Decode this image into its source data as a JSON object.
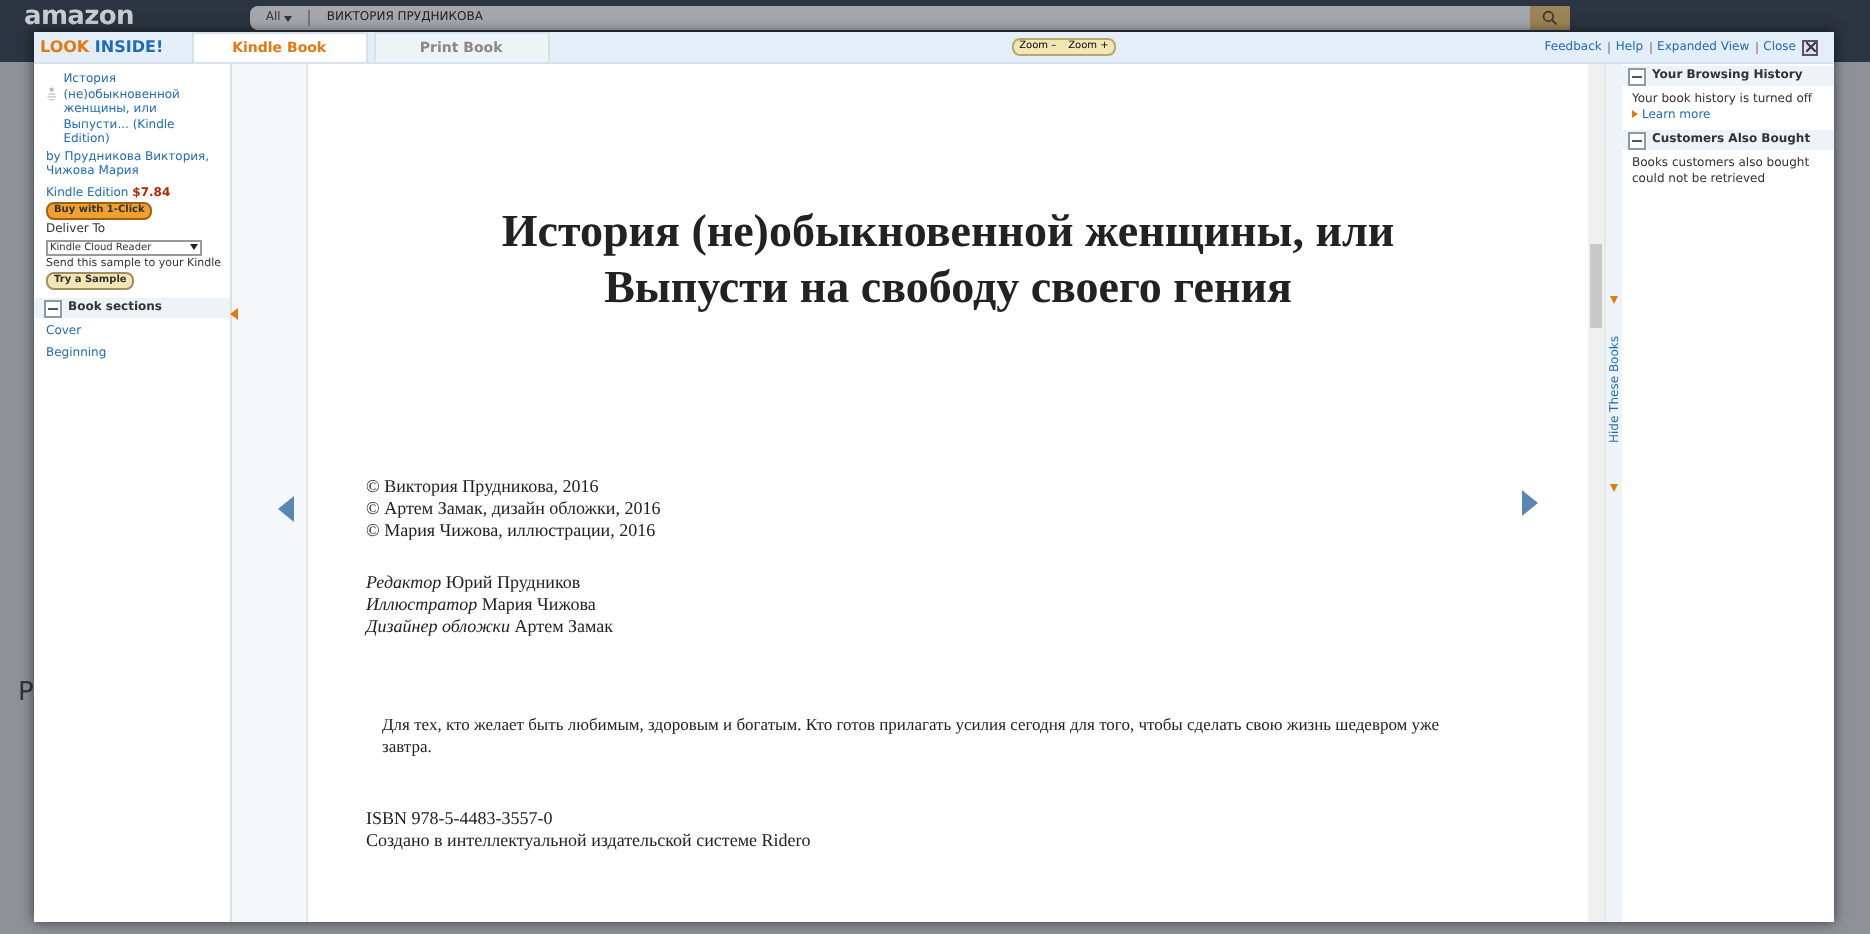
{
  "background": {
    "logo": "amazon",
    "search_scope": "All",
    "search_value": "ВИКТОРИЯ ПРУДНИКОВА",
    "fragments": [
      "P"
    ]
  },
  "viewer": {
    "brand": {
      "first": "LOOK",
      "second": "INSIDE!"
    },
    "tabs": [
      {
        "label": "Kindle Book",
        "selected": true
      },
      {
        "label": "Print Book",
        "selected": false
      }
    ],
    "zoom_buttons": [
      "Zoom –",
      "Zoom +"
    ],
    "header_links": [
      "Feedback",
      "Help",
      "Expanded View",
      "Close"
    ],
    "book": {
      "title": "История (не)обыкновенной женщины, или Выпусти... (Kindle Edition)",
      "author": "by Прудникова Виктория, Чижова Мария",
      "format": "Kindle Edition",
      "price": "$7.84",
      "buy_button": "Buy with 1-Click",
      "deliver_label": "Deliver To",
      "deliver_value": "Kindle Cloud Reader",
      "send_text": "Send this sample to your Kindle",
      "sample_button": "Try a Sample"
    },
    "sections": {
      "title": "Book sections",
      "expanded": true,
      "items": [
        "Cover",
        "Beginning"
      ]
    },
    "page": {
      "title": "История (не)обыкновенной женщины, или Выпусти на свободу своего гения",
      "copyrights": [
        "© Виктория Прудникова, 2016",
        "© Артем Замак, дизайн обложки, 2016",
        "© Мария Чижова, иллюстрации, 2016"
      ],
      "credits": [
        {
          "role": "Редактор",
          "name": "Юрий Прудников"
        },
        {
          "role": "Иллюстратор",
          "name": "Мария Чижова"
        },
        {
          "role": "Дизайнер обложки",
          "name": "Артем Замак"
        }
      ],
      "dedication": "Для тех, кто желает быть любимым, здоровым и богатым. Кто готов прилагать усилия сегодня для того, чтобы сделать свою жизнь шедевром уже завтра.",
      "imprint": [
        "ISBN 978-5-4483-3557-0",
        "Создано в интеллектуальной издательской системе Ridero"
      ]
    },
    "hide_label": "Hide These Books",
    "panels": [
      {
        "title": "Your Browsing History",
        "expanded": true,
        "text": "Your book history is turned off",
        "link": "Learn more"
      },
      {
        "title": "Customers Also Bought",
        "expanded": true,
        "text": "Books customers also bought could not be retrieved"
      }
    ]
  }
}
